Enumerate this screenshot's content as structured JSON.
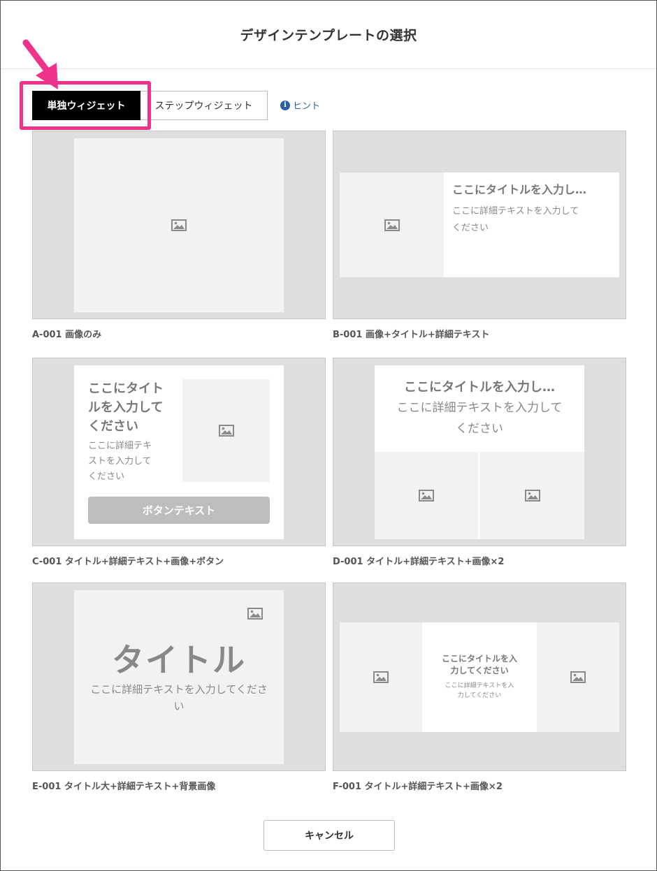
{
  "dialog": {
    "title": "デザインテンプレートの選択"
  },
  "tabs": [
    {
      "label": "単独ウィジェット",
      "active": true
    },
    {
      "label": "ステップウィジェット",
      "active": false
    }
  ],
  "hint": {
    "label": "ヒント",
    "icon": "info-icon"
  },
  "highlight_color": "#f0338a",
  "templates": [
    {
      "label": "A-001 画像のみ"
    },
    {
      "label": "B-001 画像+タイトル+詳細テキスト",
      "title": "ここにタイトルを入力し…",
      "desc1": "ここに詳細テキストを入力して",
      "desc2": "ください"
    },
    {
      "label": "C-001 タイトル+詳細テキスト+画像+ボタン",
      "title1": "ここにタイト",
      "title2": "ルを入力して",
      "title3": "ください",
      "desc1": "ここに詳細テキ",
      "desc2": "ストを入力して",
      "desc3": "ください",
      "button": "ボタンテキスト"
    },
    {
      "label": "D-001 タイトル+詳細テキスト+画像×2",
      "title": "ここにタイトルを入力し…",
      "desc1": "ここに詳細テキストを入力して",
      "desc2": "ください"
    },
    {
      "label": "E-001 タイトル大+詳細テキスト+背景画像",
      "title": "タイトル",
      "desc1": "ここに詳細テキストを入力してくださ",
      "desc2": "い"
    },
    {
      "label": "F-001 タイトル+詳細テキスト+画像×2",
      "title1": "ここにタイトルを入",
      "title2": "力してください",
      "desc1": "ここに詳細テキストを入",
      "desc2": "力してください"
    }
  ],
  "footer": {
    "cancel_label": "キャンセル"
  }
}
